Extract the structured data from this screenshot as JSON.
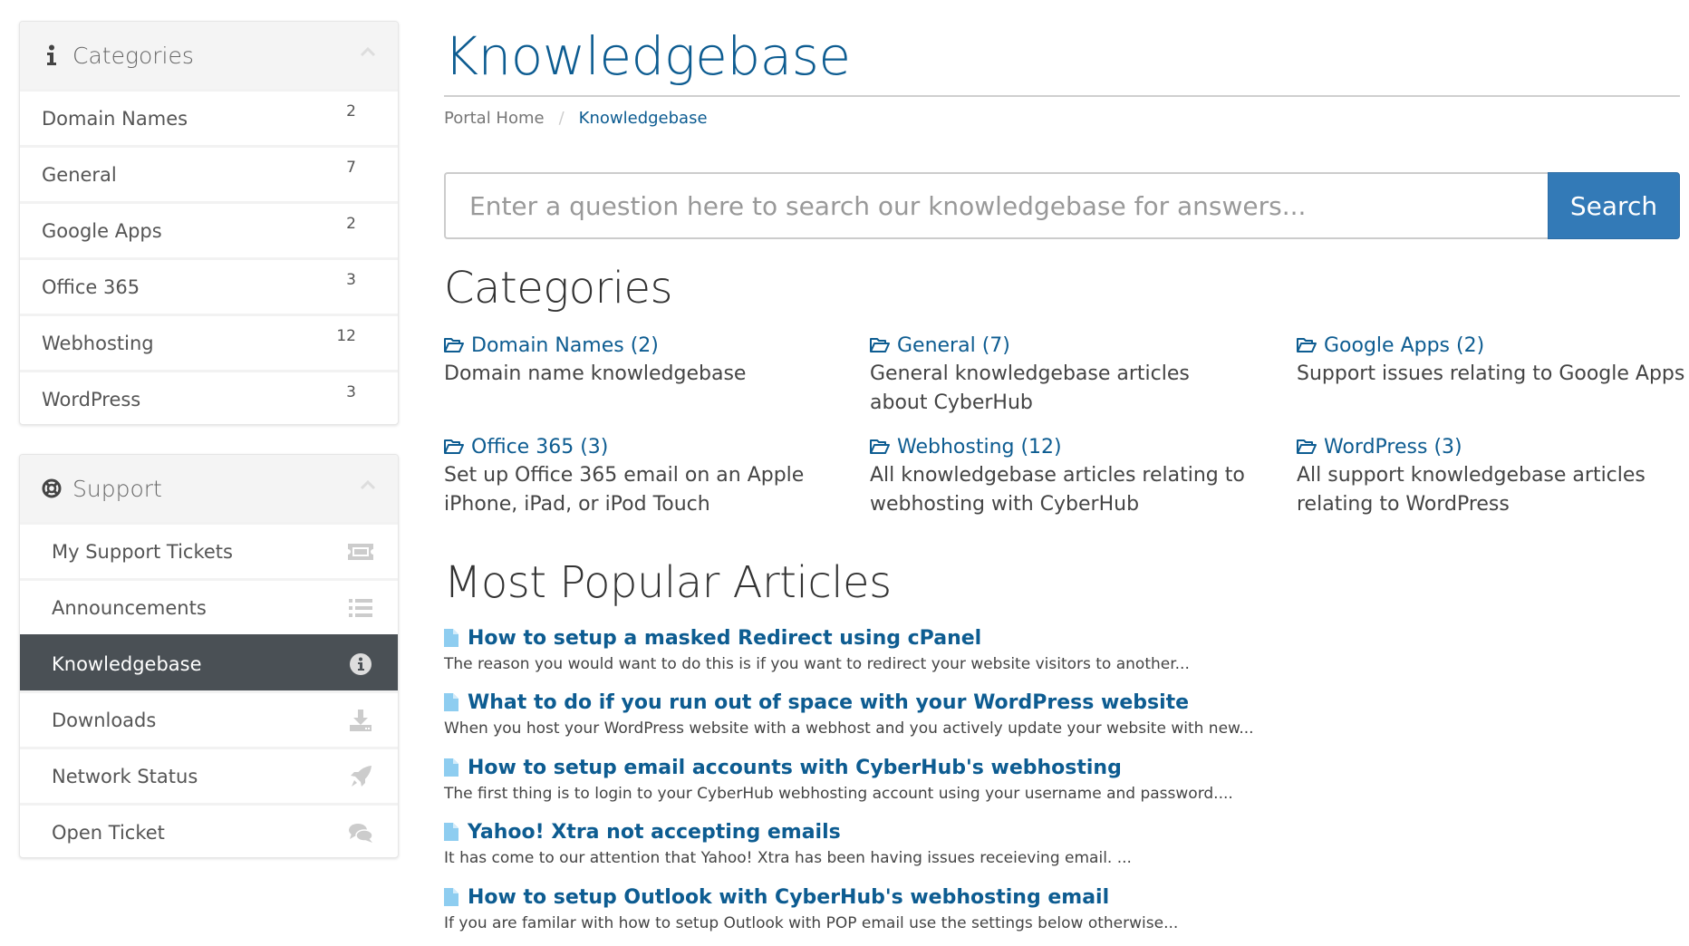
{
  "sidebar": {
    "categories_panel": {
      "title": "Categories",
      "icon": "info-icon",
      "items": [
        {
          "label": "Domain Names",
          "count": "2"
        },
        {
          "label": "General",
          "count": "7"
        },
        {
          "label": "Google Apps",
          "count": "2"
        },
        {
          "label": "Office 365",
          "count": "3"
        },
        {
          "label": "Webhosting",
          "count": "12"
        },
        {
          "label": "WordPress",
          "count": "3"
        }
      ]
    },
    "support_panel": {
      "title": "Support",
      "icon": "life-ring-icon",
      "items": [
        {
          "label": "My Support Tickets",
          "icon": "ticket-icon"
        },
        {
          "label": "Announcements",
          "icon": "list-icon"
        },
        {
          "label": "Knowledgebase",
          "icon": "info-circle-icon",
          "active": true
        },
        {
          "label": "Downloads",
          "icon": "download-icon"
        },
        {
          "label": "Network Status",
          "icon": "rocket-icon"
        },
        {
          "label": "Open Ticket",
          "icon": "comments-icon"
        }
      ]
    }
  },
  "header": {
    "title": "Knowledgebase",
    "breadcrumb": [
      {
        "label": "Portal Home"
      },
      {
        "label": "Knowledgebase"
      }
    ],
    "breadcrumb_separator": "/"
  },
  "search": {
    "placeholder": "Enter a question here to search our knowledgebase for answers...",
    "value": "",
    "button_label": "Search"
  },
  "categories": {
    "heading": "Categories",
    "items": [
      {
        "link": "Domain Names (2)",
        "description": "Domain name knowledgebase"
      },
      {
        "link": "General (7)",
        "description": "General knowledgebase articles about CyberHub"
      },
      {
        "link": "Google Apps (2)",
        "description": "Support issues relating to Google Apps"
      },
      {
        "link": "Office 365 (3)",
        "description": "Set up Office 365 email on an Apple iPhone, iPad, or iPod Touch"
      },
      {
        "link": "Webhosting (12)",
        "description": "All knowledgebase articles relating to webhosting with CyberHub"
      },
      {
        "link": "WordPress (3)",
        "description": "All support knowledgebase articles relating to WordPress"
      }
    ]
  },
  "popular": {
    "heading": "Most Popular Articles",
    "articles": [
      {
        "title": "How to setup a masked Redirect using cPanel",
        "excerpt": "The reason you would want to do this is if you want to redirect your website visitors to another..."
      },
      {
        "title": "What to do if you run out of space with your WordPress website",
        "excerpt": "When you host your WordPress website with a webhost and you actively update your website with new..."
      },
      {
        "title": "How to setup email accounts with CyberHub's webhosting",
        "excerpt": "The first thing is to login to your CyberHub webhosting account using your username and password...."
      },
      {
        "title": "Yahoo! Xtra not accepting emails",
        "excerpt": "It has come to our attention that Yahoo! Xtra has been having issues receieving email. ..."
      },
      {
        "title": "How to setup Outlook with CyberHub's webhosting email",
        "excerpt": "If you are familar with how to setup Outlook with POP email use the settings below otherwise..."
      }
    ]
  },
  "colors": {
    "link": "#0d5c91",
    "primary_button": "#337ab7",
    "active_item": "#4a5055",
    "doc_icon": "#8ecdf0"
  }
}
